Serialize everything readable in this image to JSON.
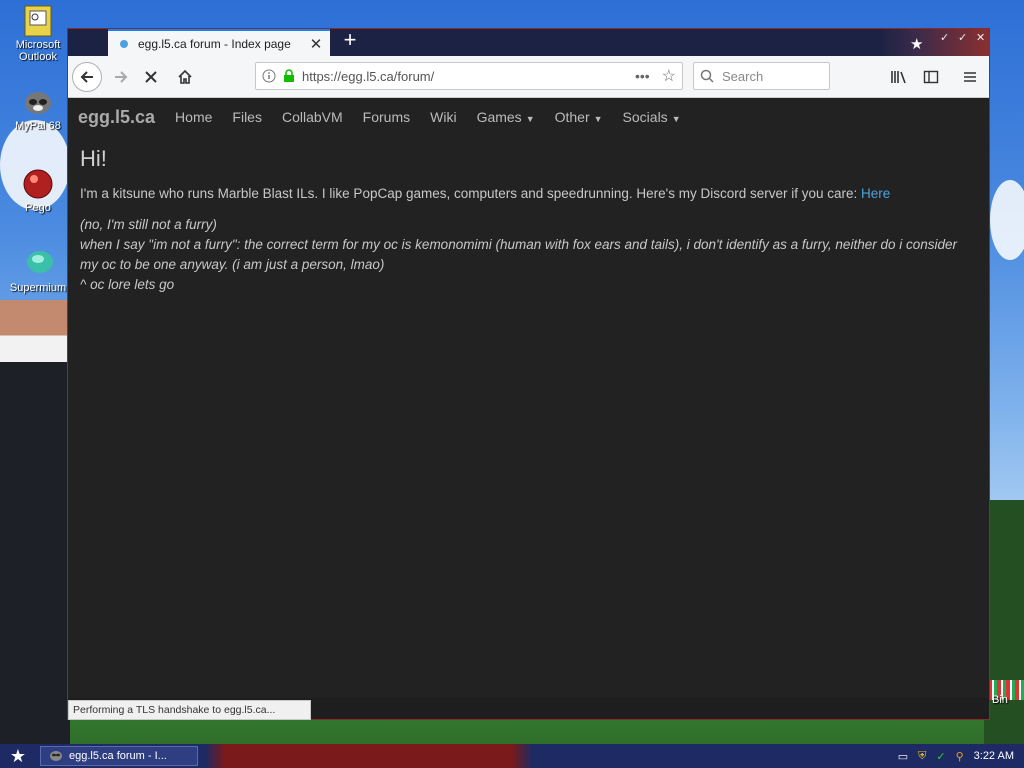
{
  "desktop": {
    "icons": [
      {
        "label": "Microsoft Outlook"
      },
      {
        "label": "MyPal 68"
      },
      {
        "label": "Pego"
      },
      {
        "label": "Supermium"
      }
    ],
    "partial_right_label": "Bin"
  },
  "browser": {
    "tab": {
      "title": "egg.l5.ca forum - Index page"
    },
    "url": "https://egg.l5.ca/forum/",
    "search_placeholder": "Search",
    "status": "Performing a TLS handshake to egg.l5.ca..."
  },
  "site": {
    "brand": "egg.l5.ca",
    "nav": [
      {
        "label": "Home",
        "dropdown": false
      },
      {
        "label": "Files",
        "dropdown": false
      },
      {
        "label": "CollabVM",
        "dropdown": false
      },
      {
        "label": "Forums",
        "dropdown": false
      },
      {
        "label": "Wiki",
        "dropdown": false
      },
      {
        "label": "Games",
        "dropdown": true
      },
      {
        "label": "Other",
        "dropdown": true
      },
      {
        "label": "Socials",
        "dropdown": true
      }
    ],
    "heading": "Hi!",
    "intro": "I'm a kitsune who runs Marble Blast ILs. I like PopCap games, computers and speedrunning. Here's my Discord server if you care: ",
    "intro_link": "Here",
    "italic_lines": [
      "(no, I'm still not a furry)",
      "when I say \"im not a furry\": the correct term for my oc is kemonomimi (human with fox ears and tails), i don't identify as a furry, neither do i consider my oc to be one anyway. (i am just a person, lmao)",
      "^ oc lore lets go"
    ]
  },
  "taskbar": {
    "task_label": "egg.l5.ca forum - I...",
    "clock": "3:22 AM"
  }
}
